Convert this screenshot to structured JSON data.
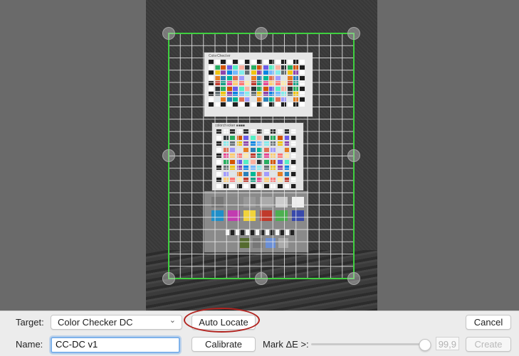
{
  "toolbar": {
    "target_label": "Target:",
    "target_value": "Color Checker DC",
    "auto_locate_label": "Auto Locate",
    "cancel_label": "Cancel",
    "name_label": "Name:",
    "name_value": "CC-DC v1",
    "calibrate_label": "Calibrate",
    "mark_label": "Mark ΔE >:",
    "mark_value": "99,9",
    "mark_slider_level": 0.95,
    "create_label": "Create"
  },
  "chart_text": {
    "top_brand": "ColorChecker",
    "mid_brand": "colorchecker ■■■■"
  },
  "colors": {
    "grid_border": "#3fd03f",
    "grid_lines": "#e6e6e6",
    "highlight": "#b2231f",
    "focus_ring": "#7fb2ea"
  },
  "icons": {
    "dropdown": "chevron-down-icon",
    "handle": "resize-handle-icon"
  }
}
